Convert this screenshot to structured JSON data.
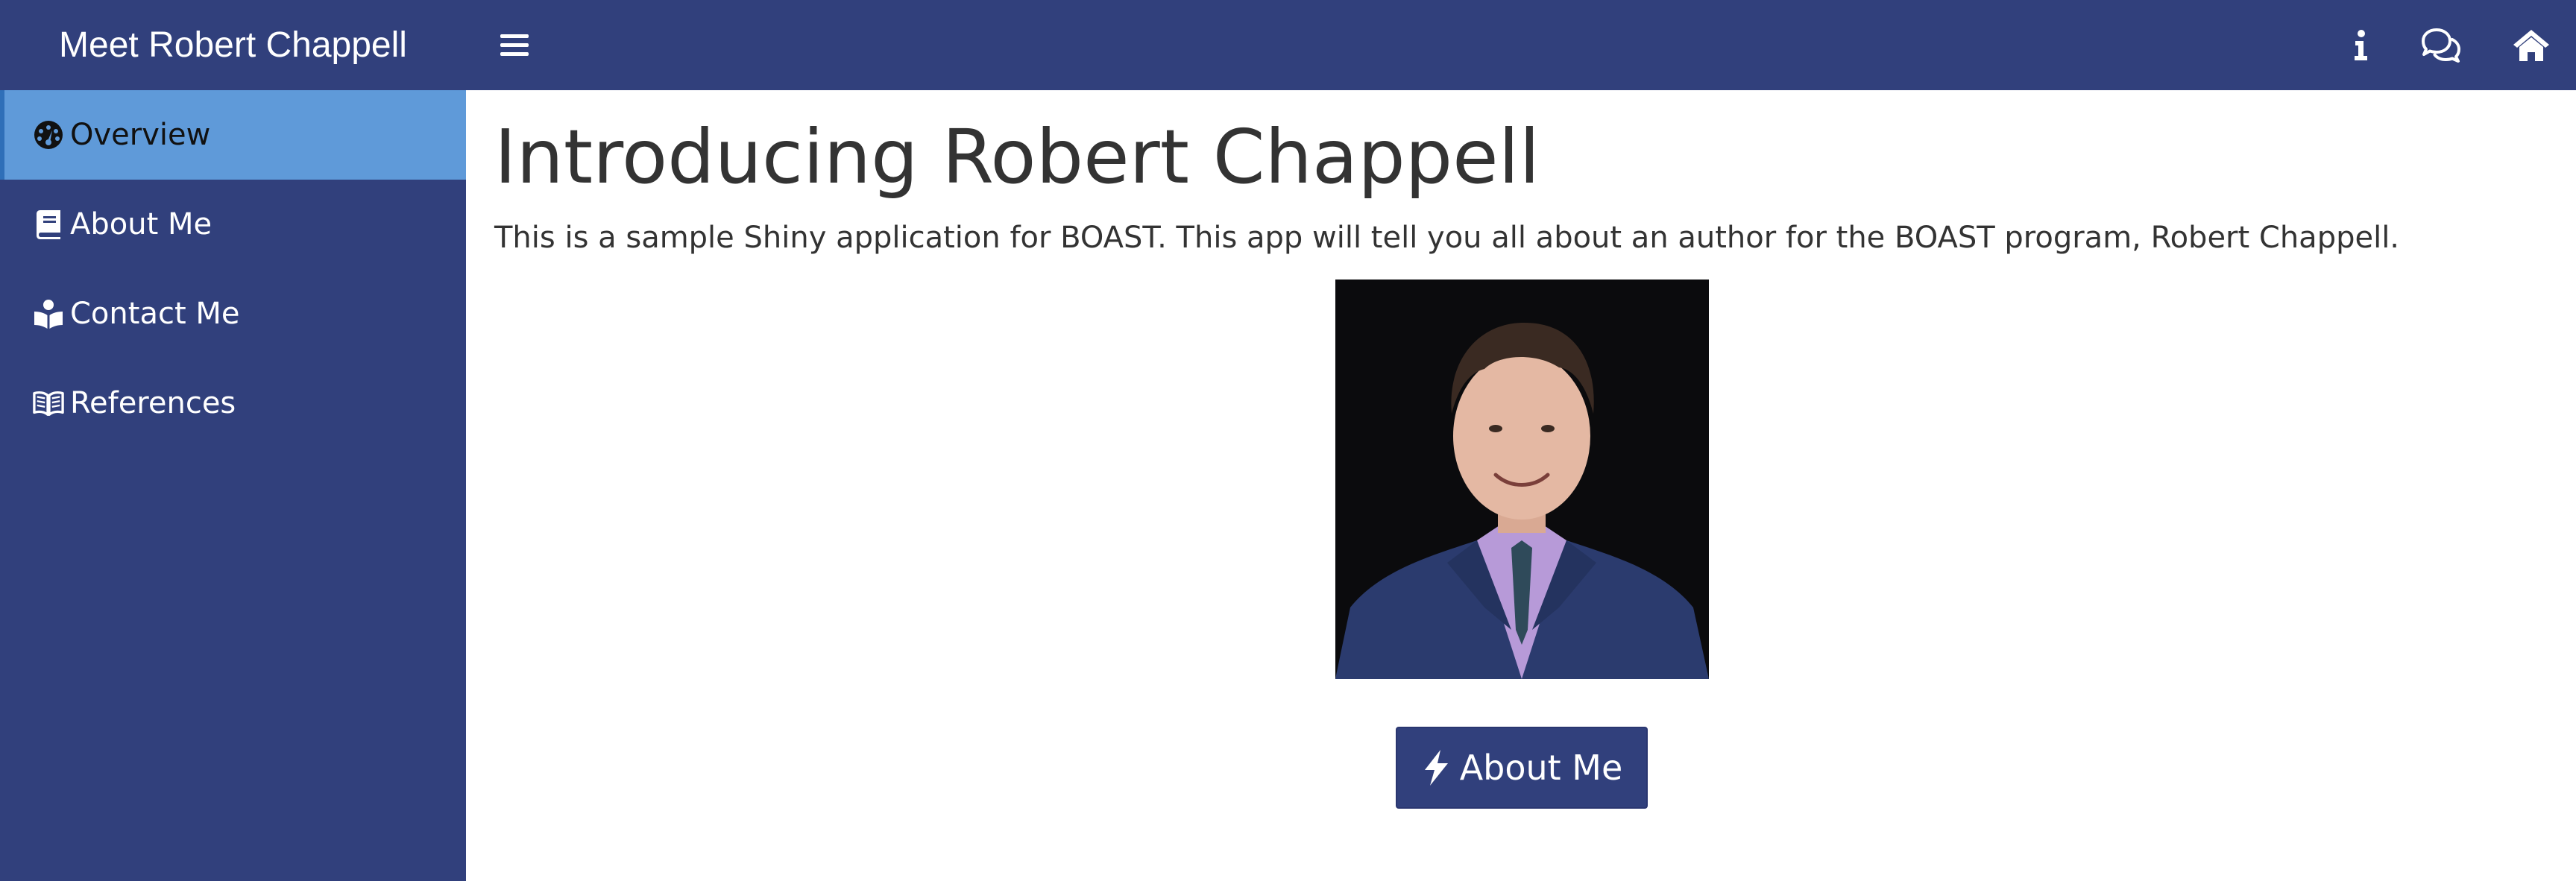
{
  "header": {
    "brand": "Meet Robert Chappell",
    "color": "#31407c",
    "icons": [
      "menu-icon",
      "info-icon",
      "comments-icon",
      "home-icon"
    ]
  },
  "sidebar": {
    "items": [
      {
        "label": "Overview",
        "icon": "dashboard-icon",
        "active": true
      },
      {
        "label": "About Me",
        "icon": "book-icon",
        "active": false
      },
      {
        "label": "Contact Me",
        "icon": "reader-icon",
        "active": false
      },
      {
        "label": "References",
        "icon": "open-book-icon",
        "active": false
      }
    ],
    "active_color": "#5f9ad9"
  },
  "main": {
    "title": "Introducing Robert Chappell",
    "intro": "This is a sample Shiny application for BOAST. This app will tell you all about an author for the BOAST program, Robert Chappell.",
    "photo": {
      "subject": "portrait-photo"
    },
    "button": {
      "label": "About Me",
      "icon": "bolt-icon"
    }
  }
}
